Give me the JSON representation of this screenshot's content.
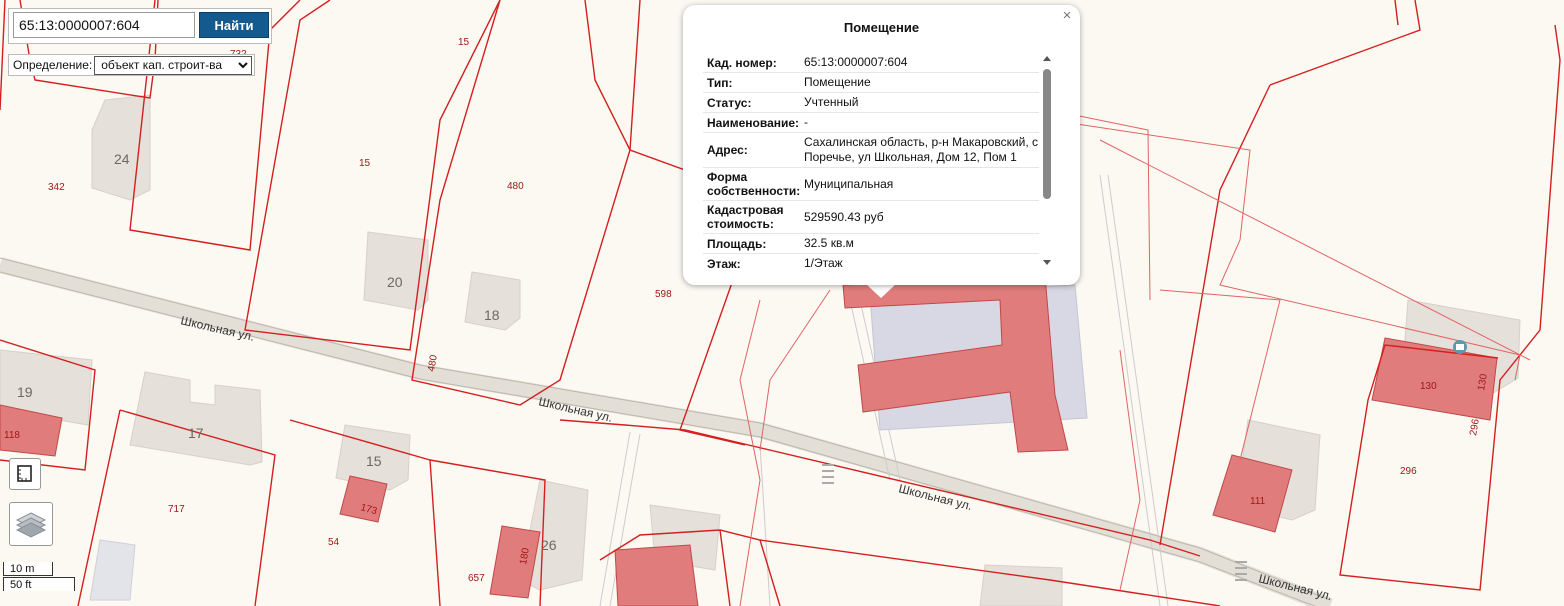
{
  "search": {
    "value": "65:13:0000007:604",
    "button_label": "Найти"
  },
  "definition": {
    "label": "Определение:",
    "selected": "объект кап. строит-ва"
  },
  "scale": {
    "metric": "10 m",
    "imperial": "50 ft"
  },
  "map": {
    "streets": [
      "Школьная ул.",
      "Школьная ул.",
      "Школьная ул.",
      "Школьная ул."
    ],
    "plot_labels": [
      "732",
      "15",
      "15",
      "342",
      "480",
      "598",
      "480",
      "118",
      "717",
      "54",
      "657",
      "173",
      "180",
      "130",
      "130",
      "296",
      "296",
      "111"
    ],
    "building_labels": [
      "24",
      "20",
      "18",
      "19",
      "17",
      "15",
      "26"
    ]
  },
  "popup": {
    "title": "Помещение",
    "rows": [
      {
        "key": "Кад. номер:",
        "value": "65:13:0000007:604"
      },
      {
        "key": "Тип:",
        "value": "Помещение"
      },
      {
        "key": "Статус:",
        "value": "Учтенный"
      },
      {
        "key": "Наименование:",
        "value": "-"
      },
      {
        "key": "Адрес:",
        "value": "Сахалинская область, р-н Макаровский, с Поречье, ул Школьная, Дом 12, Пом 1"
      },
      {
        "key": "Форма собственности:",
        "value": "Муниципальная"
      },
      {
        "key": "Кадастровая стоимость:",
        "value": "529590.43 руб"
      },
      {
        "key": "Площадь:",
        "value": "32.5 кв.м"
      },
      {
        "key": "Этаж:",
        "value": "1/Этаж"
      }
    ]
  }
}
